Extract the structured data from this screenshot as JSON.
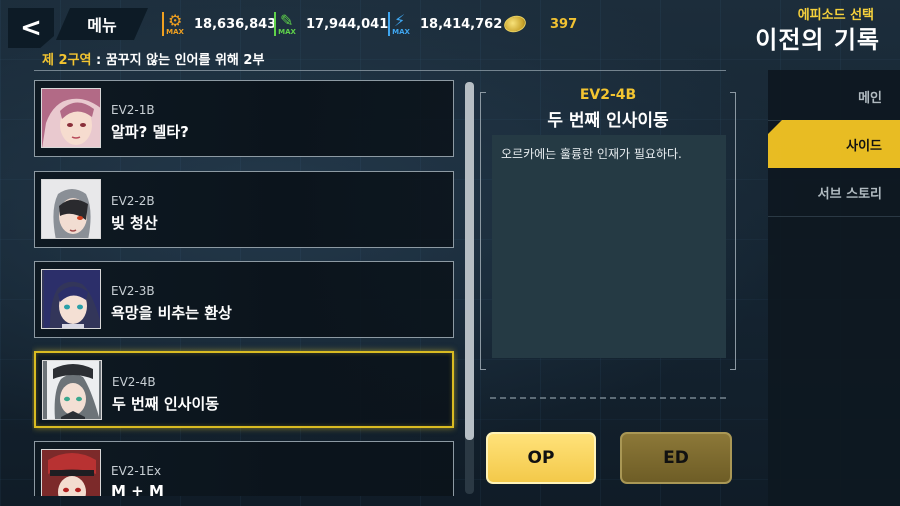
{
  "topbar": {
    "back_glyph": "<",
    "menu_label": "메뉴",
    "resources": [
      {
        "icon": "gear-icon",
        "badge": "MAX",
        "value": "18,636,843",
        "color": "#f0a020"
      },
      {
        "icon": "wrench-icon",
        "badge": "MAX",
        "value": "17,944,041",
        "color": "#5fd24a"
      },
      {
        "icon": "lightning-icon",
        "badge": "MAX",
        "value": "18,414,762",
        "color": "#3fa6f0"
      },
      {
        "icon": "coin-icon",
        "value": "397",
        "color": "#f1c232"
      }
    ],
    "episode_select": "에피소드 선택",
    "page_title": "이전의 기록"
  },
  "zone": {
    "number": "제 2구역",
    "separator": " : ",
    "name": "꿈꾸지 않는 인어를 위해 2부"
  },
  "episodes": [
    {
      "code": "EV2-1B",
      "name": "알파? 델타?",
      "selected": false
    },
    {
      "code": "EV2-2B",
      "name": "빚 청산",
      "selected": false
    },
    {
      "code": "EV2-3B",
      "name": "욕망을 비추는 환상",
      "selected": false
    },
    {
      "code": "EV2-4B",
      "name": "두 번째 인사이동",
      "selected": true
    },
    {
      "code": "EV2-1Ex",
      "name": "M + M",
      "selected": false
    }
  ],
  "detail": {
    "code": "EV2-4B",
    "title": "두 번째 인사이동",
    "description": "오르카에는 훌륭한 인재가 필요하다."
  },
  "buttons": {
    "op_label": "OP",
    "ed_label": "ED"
  },
  "side_tabs": [
    {
      "label": "메인",
      "active": false
    },
    {
      "label": "사이드",
      "active": true
    },
    {
      "label": "서브 스토리",
      "active": false
    }
  ],
  "scroll": {
    "position": 0.0,
    "visible_fraction": 0.87
  },
  "colors": {
    "accent_yellow": "#f3c531",
    "selected_border": "#d9bb22",
    "panel_bg": "#253a44"
  }
}
